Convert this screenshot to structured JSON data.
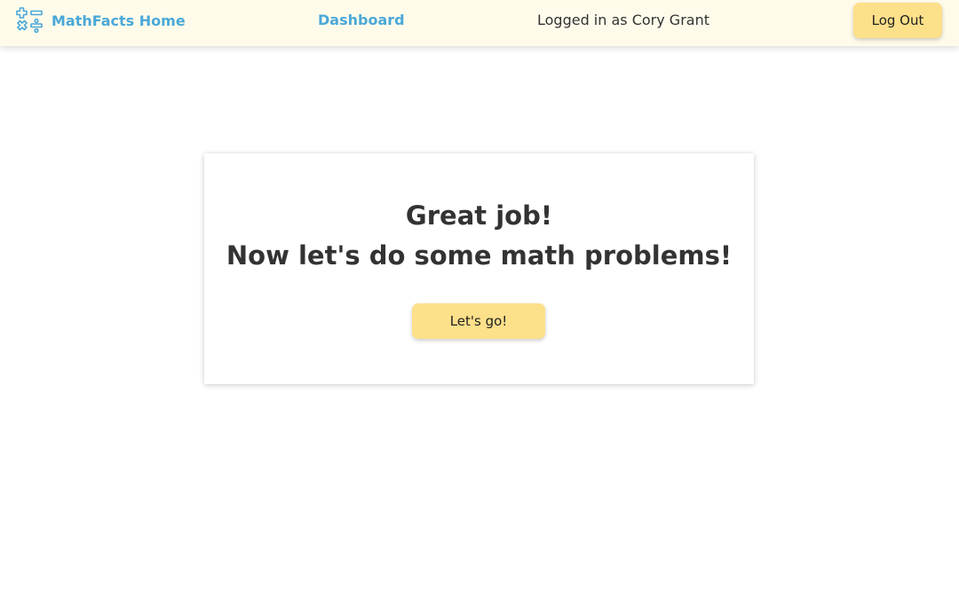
{
  "navbar": {
    "brand_label": "MathFacts Home",
    "brand_icon": "math-operators-icon",
    "dashboard_label": "Dashboard",
    "logged_in_text": "Logged in as Cory Grant",
    "logout_label": "Log Out"
  },
  "card": {
    "heading_line1": "Great job!",
    "heading_line2": "Now let's do some math problems!",
    "button_label": "Let's go!"
  },
  "colors": {
    "navbar_bg": "#fffbeb",
    "link": "#4aa8d8",
    "button_bg": "#fde08a",
    "text": "#333333"
  }
}
